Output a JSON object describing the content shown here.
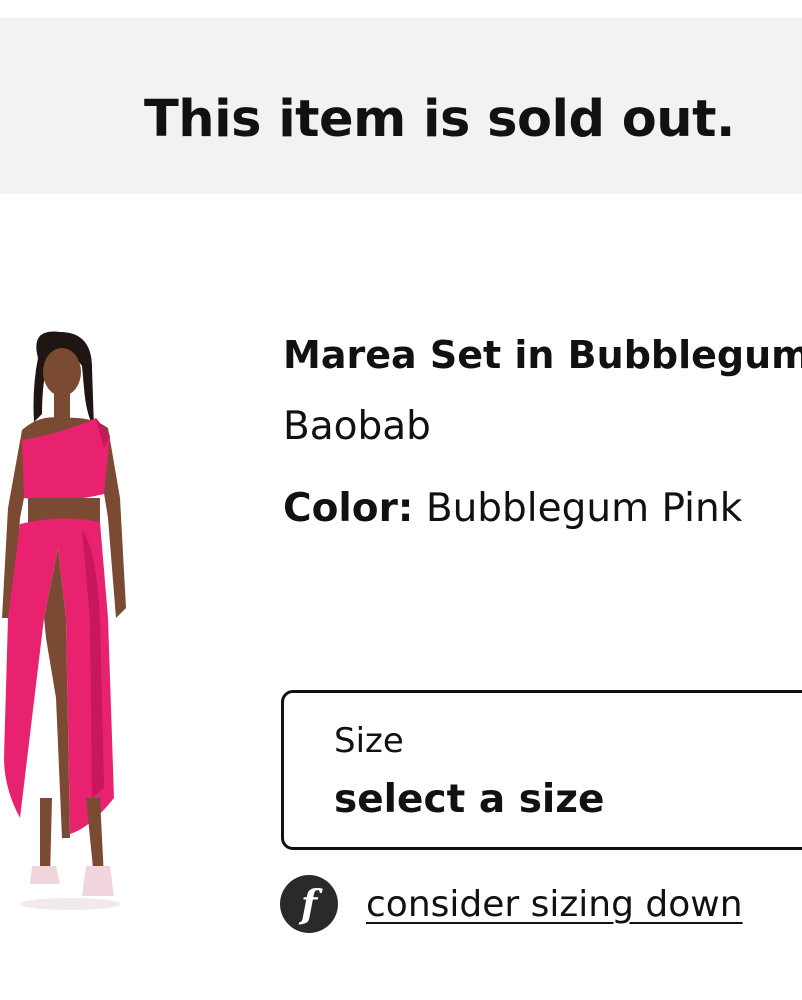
{
  "banner": {
    "message": "This item is sold out."
  },
  "product": {
    "title": "Marea Set in Bubblegum Pink",
    "brand": "Baobab",
    "color_label": "Color:",
    "color_value": "Bubblegum Pink",
    "image_alt": "product-photo"
  },
  "size_selector": {
    "label": "Size",
    "value": "select a size"
  },
  "fit_advice": {
    "icon": "fit-f-icon",
    "icon_glyph": "f",
    "link_text": "consider sizing down"
  },
  "colors": {
    "banner_bg": "#f2f2f2",
    "text": "#111111",
    "dress_pink": "#e8226f",
    "icon_bg": "#2a2a2a"
  }
}
